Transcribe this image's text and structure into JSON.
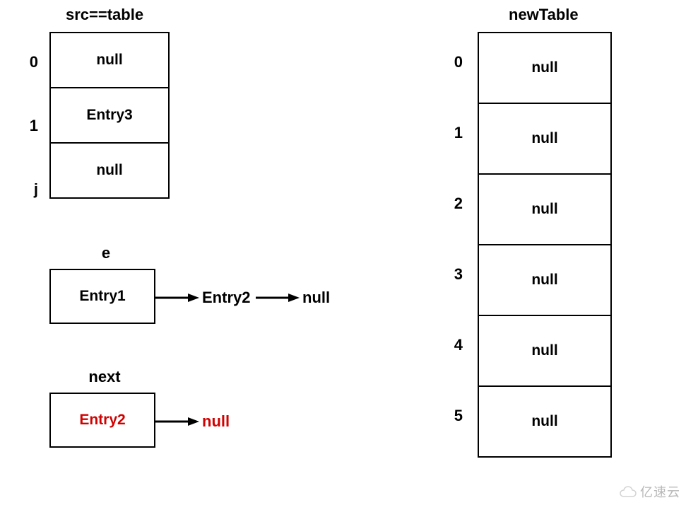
{
  "srcTable": {
    "title": "src==table",
    "rows": [
      {
        "index": "0",
        "value": "null"
      },
      {
        "index": "1",
        "value": "Entry3"
      },
      {
        "index": "j",
        "value": "null"
      }
    ]
  },
  "eBox": {
    "title": "e",
    "value": "Entry1",
    "chain": [
      {
        "text": "Entry2",
        "red": false
      },
      {
        "text": "null",
        "red": false
      }
    ]
  },
  "nextBox": {
    "title": "next",
    "value": "Entry2",
    "valueRed": true,
    "chain": [
      {
        "text": "null",
        "red": true
      }
    ]
  },
  "newTable": {
    "title": "newTable",
    "rows": [
      {
        "index": "0",
        "value": "null"
      },
      {
        "index": "1",
        "value": "null"
      },
      {
        "index": "2",
        "value": "null"
      },
      {
        "index": "3",
        "value": "null"
      },
      {
        "index": "4",
        "value": "null"
      },
      {
        "index": "5",
        "value": "null"
      }
    ]
  },
  "watermark": "亿速云"
}
